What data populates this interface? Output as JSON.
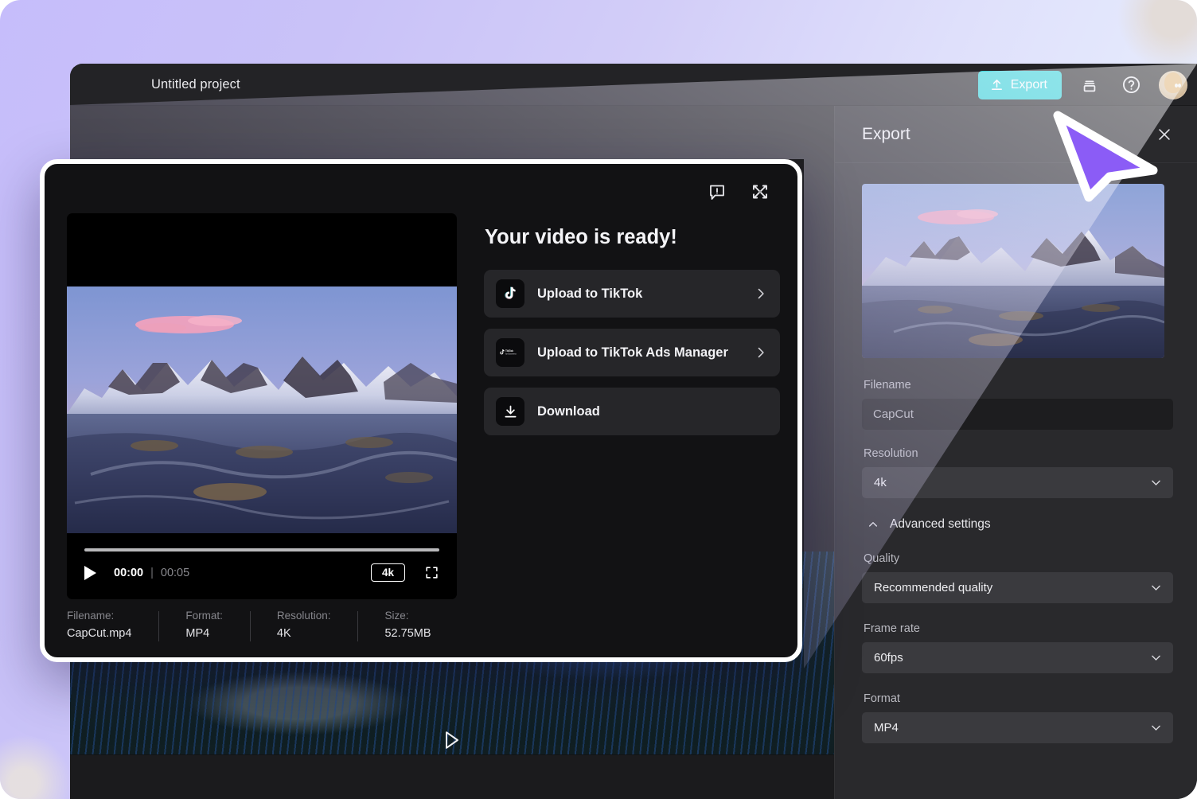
{
  "app": {
    "project_title": "Untitled project",
    "export_button_label": "Export",
    "export_icon": "upload-icon",
    "layers_icon": "layers-icon",
    "help_icon": "help-circle-icon",
    "avatar_icon": "user-avatar"
  },
  "export_panel": {
    "title": "Export",
    "close_icon": "close-icon",
    "fields": {
      "filename_label": "Filename",
      "filename_value": "CapCut",
      "resolution_label": "Resolution",
      "resolution_value": "4k",
      "advanced_label": "Advanced settings",
      "advanced_icon": "chevron-up-icon",
      "quality_label": "Quality",
      "quality_value": "Recommended quality",
      "framerate_label": "Frame rate",
      "framerate_value": "60fps",
      "format_label": "Format",
      "format_value": "MP4"
    }
  },
  "modal": {
    "title": "Your video is ready!",
    "feedback_icon": "feedback-icon",
    "minimize_icon": "minimize-icon",
    "actions": [
      {
        "label": "Upload to TikTok",
        "icon": "tiktok-icon",
        "has_chevron": true
      },
      {
        "label": "Upload to TikTok Ads Manager",
        "icon": "tiktok-ads-icon",
        "has_chevron": true
      },
      {
        "label": "Download",
        "icon": "download-icon",
        "has_chevron": false
      }
    ],
    "player": {
      "play_icon": "play-icon",
      "current_time": "00:00",
      "time_separator": "|",
      "duration": "00:05",
      "quality_badge": "4k",
      "fullscreen_icon": "fullscreen-icon"
    },
    "meta": [
      {
        "key": "Filename:",
        "value": "CapCut.mp4"
      },
      {
        "key": "Format:",
        "value": "MP4"
      },
      {
        "key": "Resolution:",
        "value": "4K"
      },
      {
        "key": "Size:",
        "value": "52.75MB"
      }
    ]
  },
  "editor": {
    "play_outline_icon": "play-outline-icon"
  },
  "colors": {
    "accent_teal": "#2fd2d8",
    "cursor_purple": "#8b5cf6",
    "panel_bg": "#29292c",
    "modal_bg": "#121214",
    "canvas_lavender": "#c6bdfb"
  }
}
